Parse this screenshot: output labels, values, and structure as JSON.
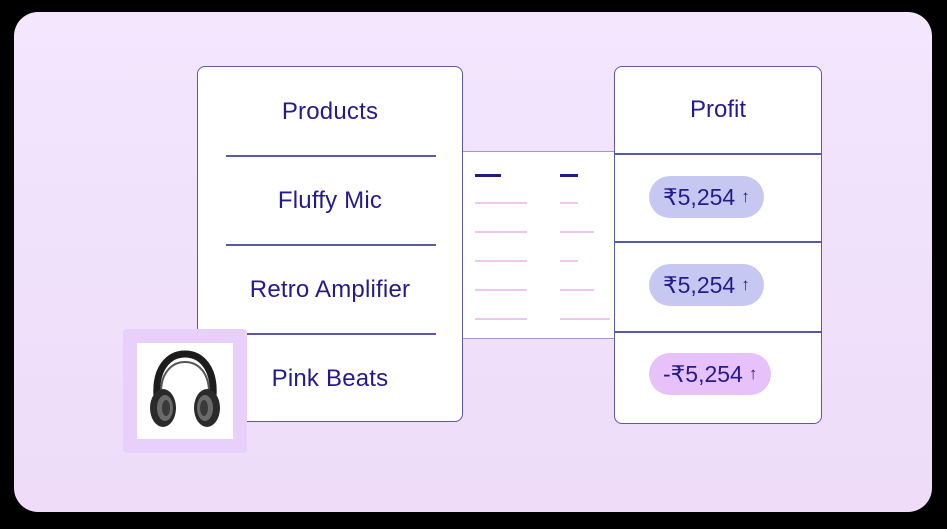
{
  "products": {
    "header": "Products",
    "items": [
      "Fluffy Mic",
      "Retro Amplifier",
      "Pink Beats"
    ]
  },
  "profit": {
    "header": "Profit",
    "rows": [
      {
        "value": "₹5,254",
        "arrow": "↑",
        "color": "#c7c8f1"
      },
      {
        "value": "₹5,254",
        "arrow": "↑",
        "color": "#c7c8f1"
      },
      {
        "value": "-₹5,254",
        "arrow": "↑",
        "color": "#e6c1fa"
      }
    ]
  },
  "colors": {
    "background": "#f1e2fb",
    "text": "#241a8c",
    "border": "#5a58a8",
    "thumbnail_frame": "#e8d0fb"
  },
  "thumbnail": {
    "icon": "headphones-icon"
  }
}
